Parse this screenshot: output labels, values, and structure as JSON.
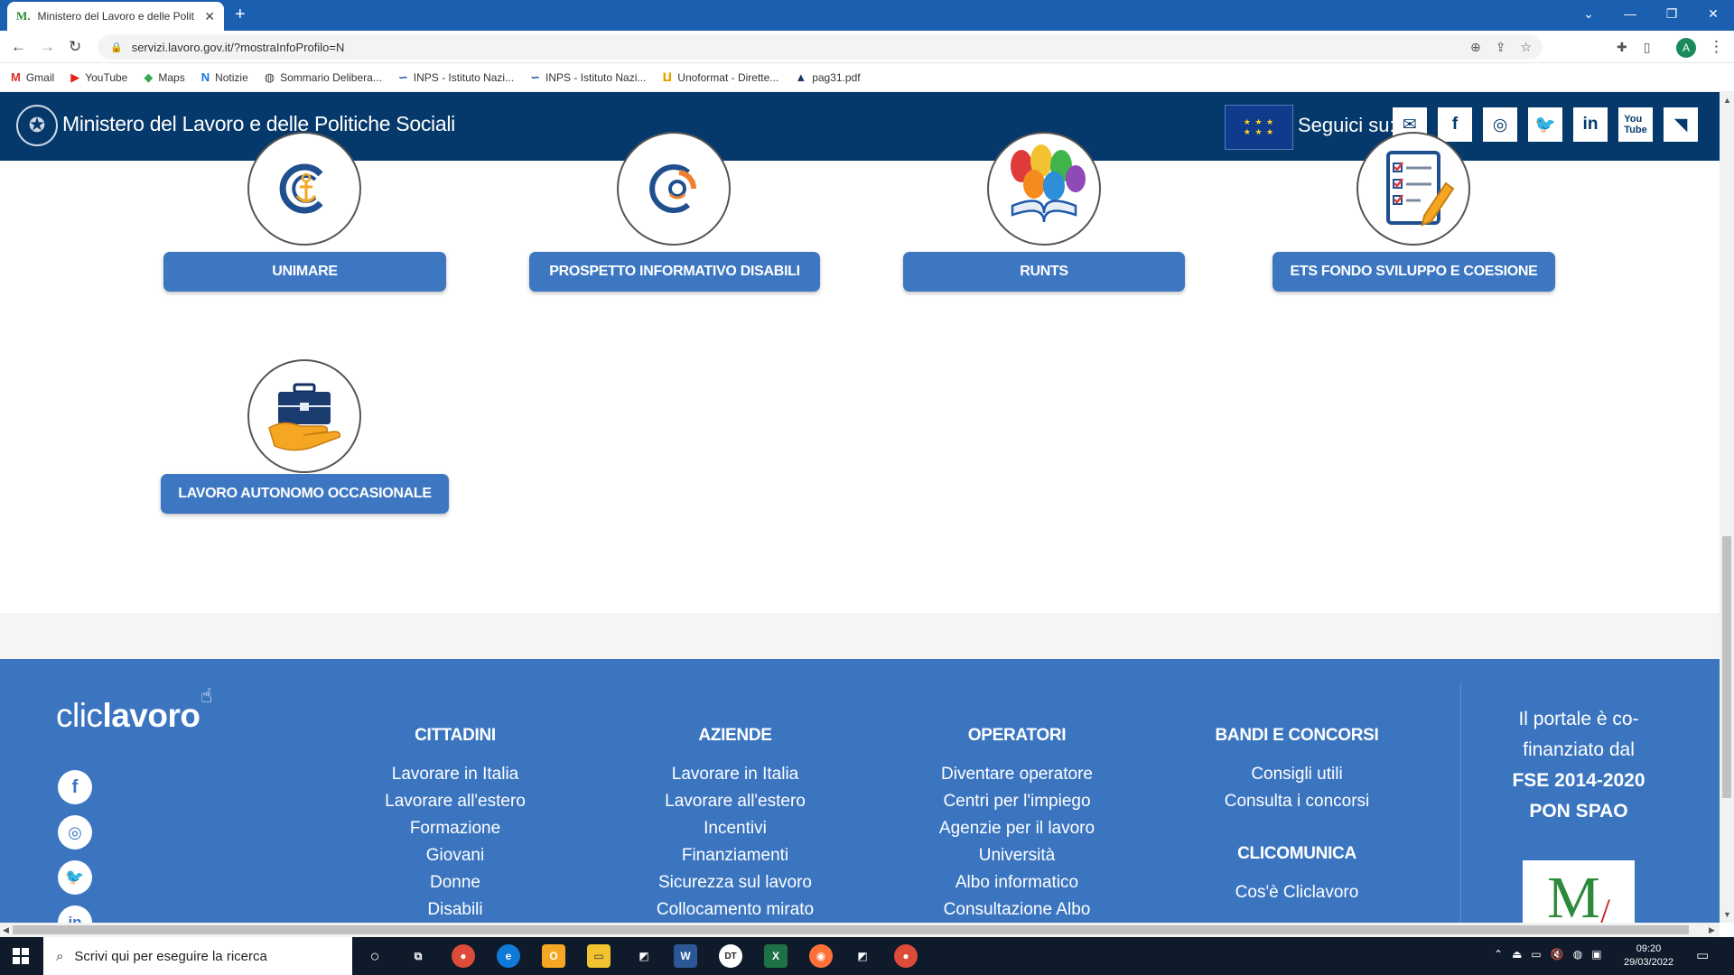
{
  "browser": {
    "tab_title": "Ministero del Lavoro e delle Polit",
    "tab_favicon": "M.",
    "url": "servizi.lavoro.gov.it/?mostraInfoProfilo=N",
    "profile_initial": "A",
    "bookmarks": [
      {
        "label": "Gmail",
        "icon": "gmail-icon"
      },
      {
        "label": "YouTube",
        "icon": "youtube-icon"
      },
      {
        "label": "Maps",
        "icon": "maps-icon"
      },
      {
        "label": "Notizie",
        "icon": "news-icon"
      },
      {
        "label": "Sommario Delibera...",
        "icon": "globe-icon"
      },
      {
        "label": "INPS - Istituto Nazi...",
        "icon": "inps-icon"
      },
      {
        "label": "INPS - Istituto Nazi...",
        "icon": "inps-icon"
      },
      {
        "label": "Unoformat - Dirette...",
        "icon": "unoformat-icon"
      },
      {
        "label": "pag31.pdf",
        "icon": "drive-icon"
      }
    ]
  },
  "header": {
    "site_title": "Ministero del Lavoro e delle Politiche Sociali",
    "follow_label": "Seguici su:",
    "social": [
      "mail-icon",
      "facebook-icon",
      "instagram-icon",
      "twitter-icon",
      "linkedin-icon",
      "youtube-icon",
      "rss-icon"
    ]
  },
  "services": [
    {
      "label": "UNIMARE",
      "icon": "anchor-icon"
    },
    {
      "label": "PROSPETTO INFORMATIVO DISABILI",
      "icon": "disability-logo-icon"
    },
    {
      "label": "RUNTS",
      "icon": "hands-book-icon"
    },
    {
      "label": "ETS FONDO SVILUPPO E COESIONE",
      "icon": "checklist-pencil-icon"
    },
    {
      "label": "LAVORO AUTONOMO OCCASIONALE",
      "icon": "briefcase-hand-icon"
    }
  ],
  "footer": {
    "logo_left": "clic",
    "logo_right": "lavoro",
    "social": [
      "facebook-icon",
      "instagram-icon",
      "twitter-icon",
      "linkedin-icon"
    ],
    "columns": [
      {
        "heading": "CITTADINI",
        "links": [
          "Lavorare in Italia",
          "Lavorare all'estero",
          "Formazione",
          "Giovani",
          "Donne",
          "Disabili"
        ]
      },
      {
        "heading": "AZIENDE",
        "links": [
          "Lavorare in Italia",
          "Lavorare all'estero",
          "Incentivi",
          "Finanziamenti",
          "Sicurezza sul lavoro",
          "Collocamento mirato"
        ]
      },
      {
        "heading": "OPERATORI",
        "links": [
          "Diventare operatore",
          "Centri per l'impiego",
          "Agenzie per il lavoro",
          "Università",
          "Albo informatico",
          "Consultazione Albo"
        ]
      },
      {
        "heading": "BANDI E CONCORSI",
        "links": [
          "Consigli utili",
          "Consulta i concorsi"
        ]
      }
    ],
    "clicomunica": {
      "heading": "CLICOMUNICA",
      "links": [
        "Cos'è Cliclavoro"
      ]
    },
    "cofin_lines": [
      "Il portale è co-",
      "finanziato dal"
    ],
    "cofin_bold": [
      "FSE 2014-2020",
      "PON SPAO"
    ]
  },
  "taskbar": {
    "search_placeholder": "Scrivi qui per eseguire la ricerca",
    "time": "09:20",
    "date": "29/03/2022"
  }
}
